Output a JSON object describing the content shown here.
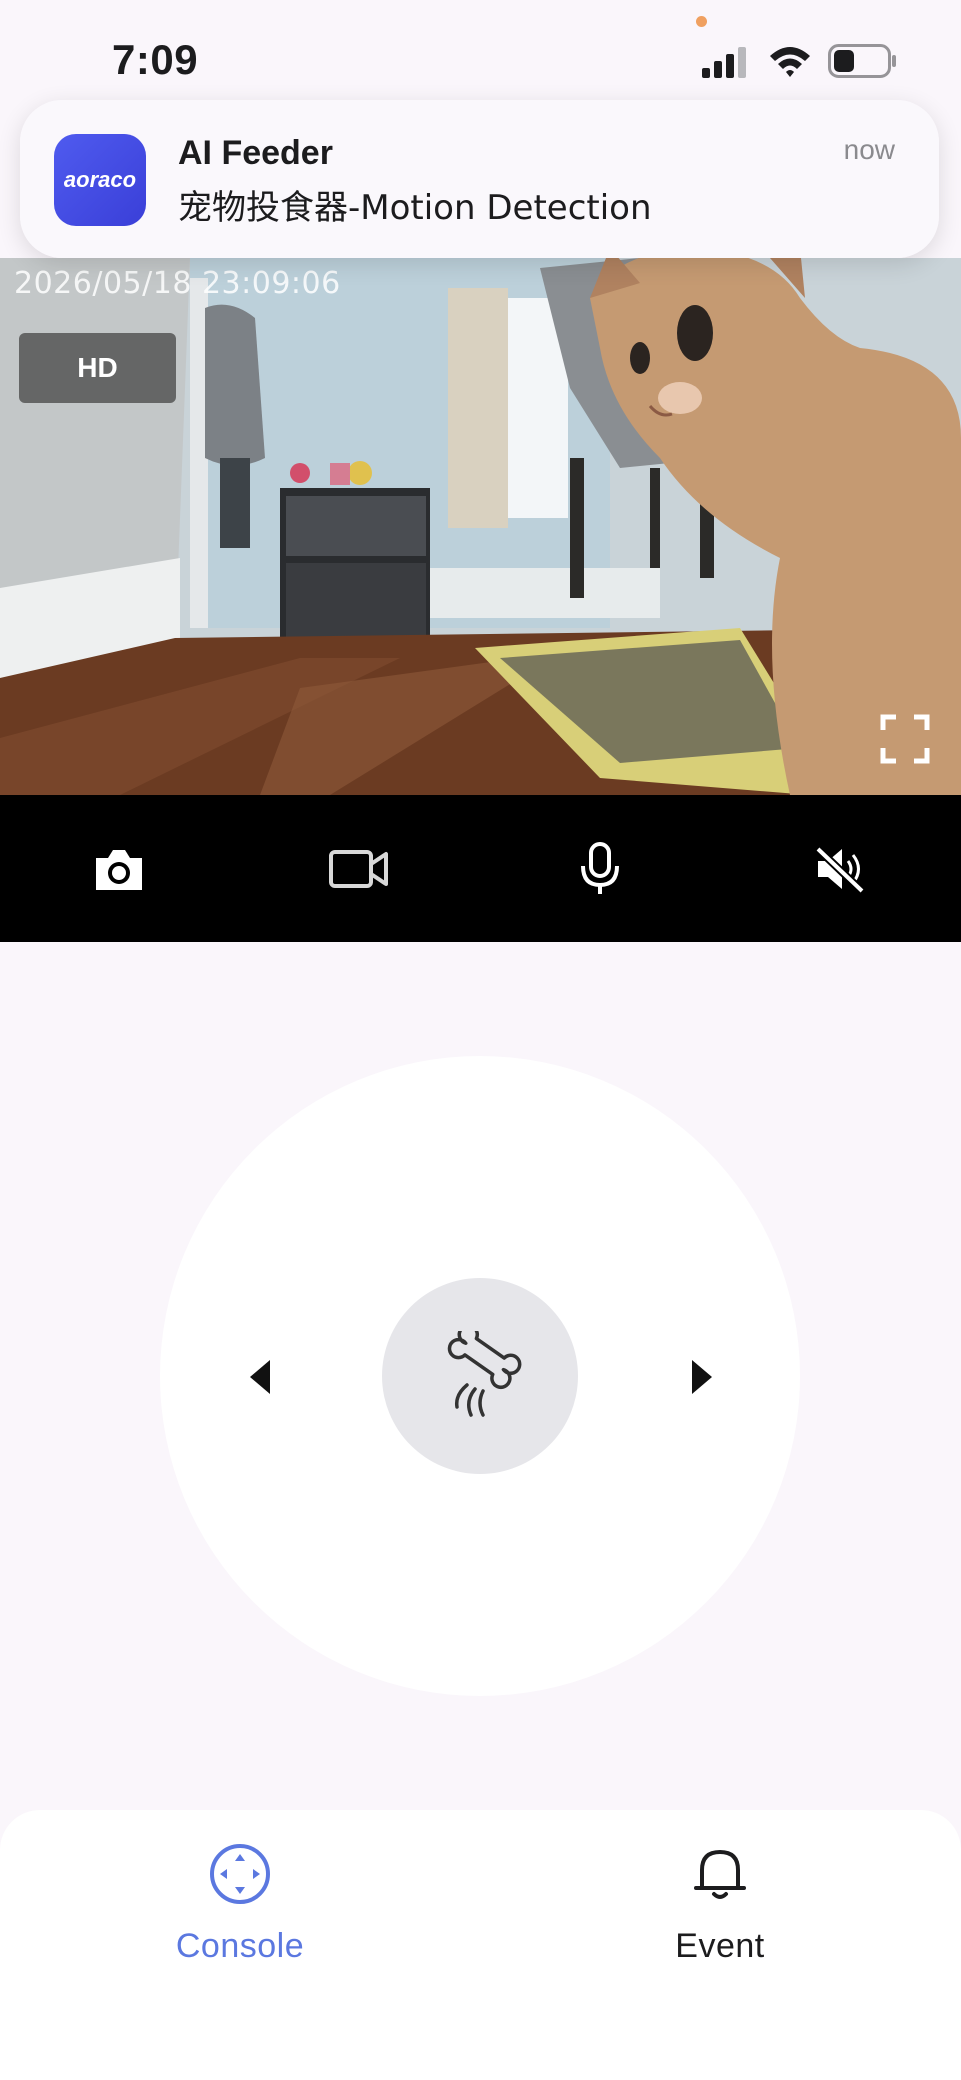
{
  "status_bar": {
    "time": "7:09"
  },
  "notification": {
    "app_name": "AI Feeder",
    "message": "宠物投食器-Motion Detection",
    "time": "now",
    "app_icon_text": "aoraco"
  },
  "camera": {
    "timestamp": "2026/05/18 23:09:06",
    "quality_label": "HD"
  },
  "toolbar": {
    "snapshot_icon": "camera-icon",
    "record_icon": "video-icon",
    "talk_icon": "microphone-icon",
    "mute_icon": "speaker-muted-icon"
  },
  "controls": {
    "feed_icon": "bone-icon"
  },
  "bottom_nav": {
    "items": [
      {
        "label": "Console",
        "icon": "console-icon",
        "active": true
      },
      {
        "label": "Event",
        "icon": "bell-icon",
        "active": false
      }
    ]
  },
  "colors": {
    "accent": "#5b78e0",
    "background": "#faf6fb",
    "toolbar": "#000000"
  }
}
